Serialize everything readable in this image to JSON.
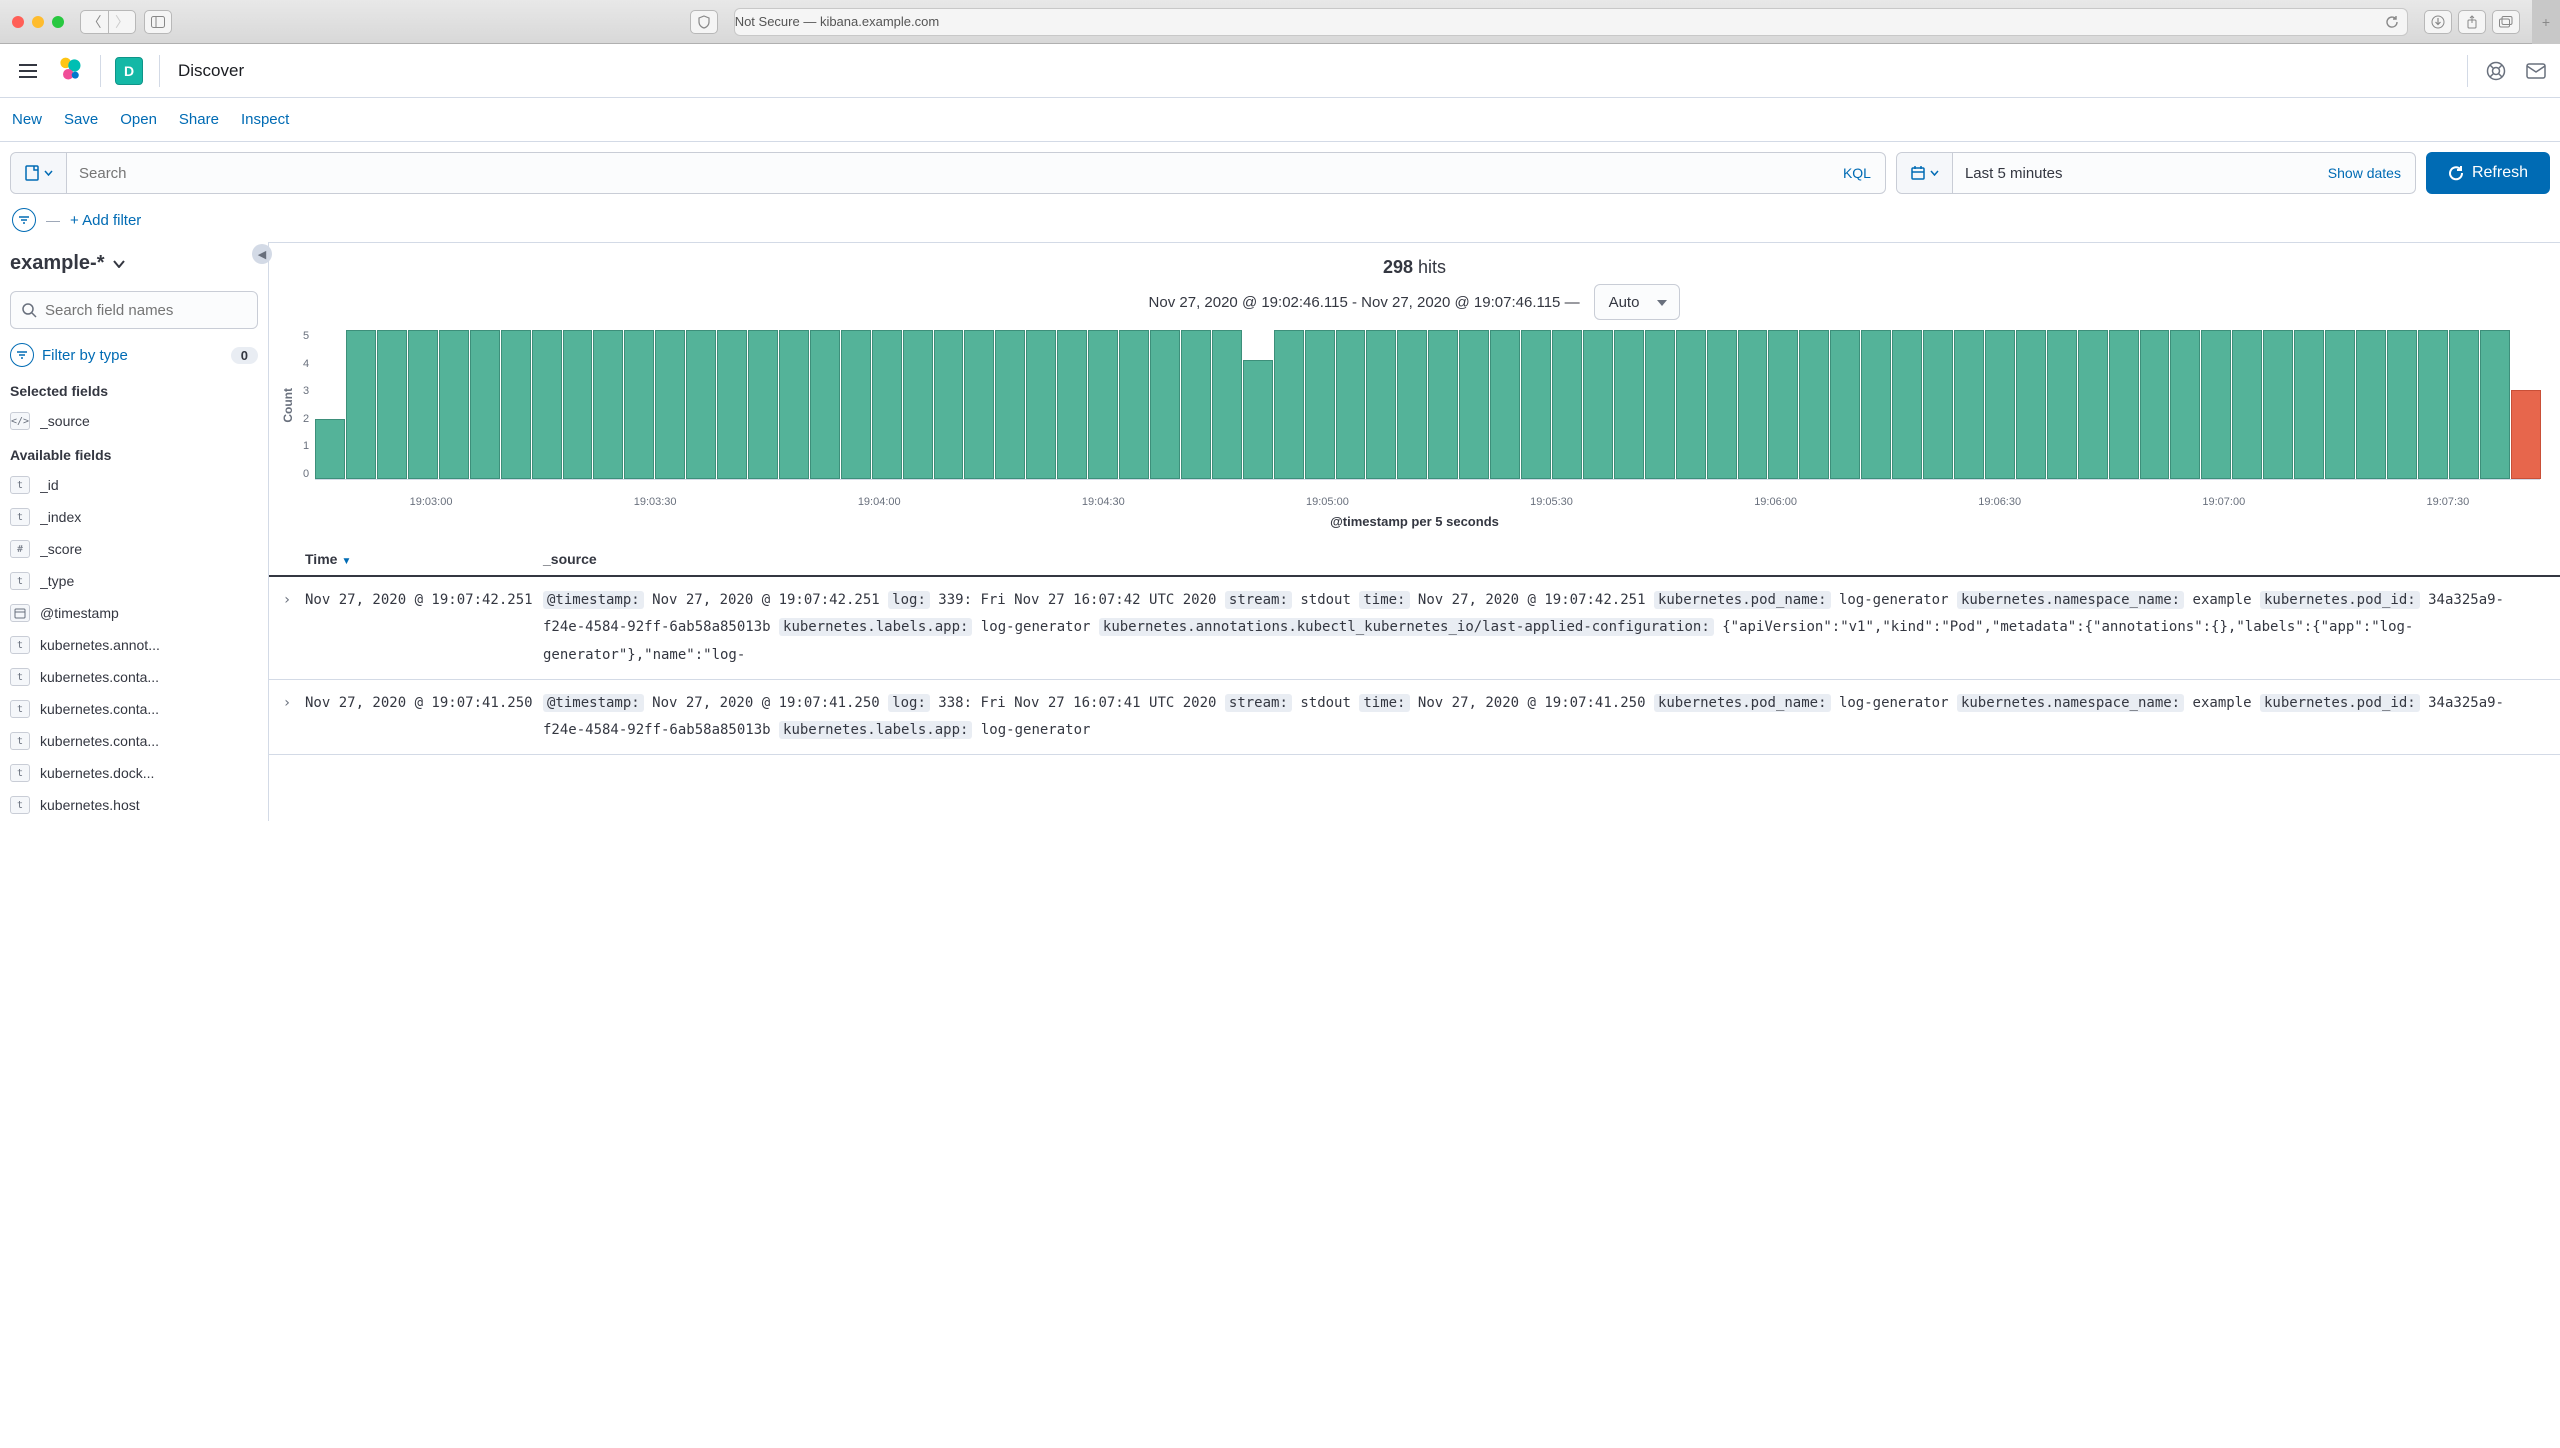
{
  "browser": {
    "url_label": "Not Secure — kibana.example.com"
  },
  "header": {
    "badge": "D",
    "title": "Discover"
  },
  "submenu": [
    "New",
    "Save",
    "Open",
    "Share",
    "Inspect"
  ],
  "search": {
    "placeholder": "Search",
    "kql": "KQL",
    "time_value": "Last 5 minutes",
    "show_dates": "Show dates",
    "refresh": "Refresh"
  },
  "filters": {
    "add_filter": "+ Add filter"
  },
  "sidebar": {
    "index_pattern": "example-*",
    "field_search_placeholder": "Search field names",
    "filter_by_type": "Filter by type",
    "type_count": "0",
    "selected_title": "Selected fields",
    "available_title": "Available fields",
    "selected_fields": [
      {
        "type": "src",
        "name": "_source"
      }
    ],
    "available_fields": [
      {
        "type": "t",
        "name": "_id"
      },
      {
        "type": "t",
        "name": "_index"
      },
      {
        "type": "#",
        "name": "_score"
      },
      {
        "type": "t",
        "name": "_type"
      },
      {
        "type": "date",
        "name": "@timestamp"
      },
      {
        "type": "t",
        "name": "kubernetes.annot..."
      },
      {
        "type": "t",
        "name": "kubernetes.conta..."
      },
      {
        "type": "t",
        "name": "kubernetes.conta..."
      },
      {
        "type": "t",
        "name": "kubernetes.conta..."
      },
      {
        "type": "t",
        "name": "kubernetes.dock..."
      },
      {
        "type": "t",
        "name": "kubernetes.host"
      }
    ]
  },
  "hits": {
    "count": "298",
    "label": "hits",
    "time_range": "Nov 27, 2020 @ 19:02:46.115 - Nov 27, 2020 @ 19:07:46.115 —",
    "interval": "Auto"
  },
  "chart_data": {
    "type": "bar",
    "ylabel": "Count",
    "xlabel": "@timestamp per 5 seconds",
    "y_ticks": [
      "5",
      "4",
      "3",
      "2",
      "1",
      "0"
    ],
    "x_ticks": [
      "19:03:00",
      "19:03:30",
      "19:04:00",
      "19:04:30",
      "19:05:00",
      "19:05:30",
      "19:06:00",
      "19:06:30",
      "19:07:00",
      "19:07:30"
    ],
    "values": [
      2,
      5,
      5,
      5,
      5,
      5,
      5,
      5,
      5,
      5,
      5,
      5,
      5,
      5,
      5,
      5,
      5,
      5,
      5,
      5,
      5,
      5,
      5,
      5,
      5,
      5,
      5,
      5,
      5,
      5,
      4,
      5,
      5,
      5,
      5,
      5,
      5,
      5,
      5,
      5,
      5,
      5,
      5,
      5,
      5,
      5,
      5,
      5,
      5,
      5,
      5,
      5,
      5,
      5,
      5,
      5,
      5,
      5,
      5,
      5,
      5,
      5,
      5,
      5,
      5,
      5,
      5,
      5,
      5,
      5,
      5,
      3
    ],
    "highlight_last": true
  },
  "table": {
    "col_time": "Time",
    "col_source": "_source",
    "rows": [
      {
        "time": "Nov 27, 2020 @ 19:07:42.251",
        "kvs": [
          {
            "k": "@timestamp:",
            "v": "Nov 27, 2020 @ 19:07:42.251"
          },
          {
            "k": "log:",
            "v": "339: Fri Nov 27 16:07:42 UTC 2020"
          },
          {
            "k": "stream:",
            "v": "stdout"
          },
          {
            "k": "time:",
            "v": "Nov 27, 2020 @ 19:07:42.251"
          },
          {
            "k": "kubernetes.pod_name:",
            "v": "log-generator"
          },
          {
            "k": "kubernetes.namespace_name:",
            "v": "example"
          },
          {
            "k": "kubernetes.pod_id:",
            "v": "34a325a9-f24e-4584-92ff-6ab58a85013b"
          },
          {
            "k": "kubernetes.labels.app:",
            "v": "log-generator"
          },
          {
            "k": "kubernetes.annotations.kubectl_kubernetes_io/last-applied-configuration:",
            "v": "{\"apiVersion\":\"v1\",\"kind\":\"Pod\",\"metadata\":{\"annotations\":{},\"labels\":{\"app\":\"log-generator\"},\"name\":\"log-"
          }
        ]
      },
      {
        "time": "Nov 27, 2020 @ 19:07:41.250",
        "kvs": [
          {
            "k": "@timestamp:",
            "v": "Nov 27, 2020 @ 19:07:41.250"
          },
          {
            "k": "log:",
            "v": "338: Fri Nov 27 16:07:41 UTC 2020"
          },
          {
            "k": "stream:",
            "v": "stdout"
          },
          {
            "k": "time:",
            "v": "Nov 27, 2020 @ 19:07:41.250"
          },
          {
            "k": "kubernetes.pod_name:",
            "v": "log-generator"
          },
          {
            "k": "kubernetes.namespace_name:",
            "v": "example"
          },
          {
            "k": "kubernetes.pod_id:",
            "v": "34a325a9-f24e-4584-92ff-6ab58a85013b"
          },
          {
            "k": "kubernetes.labels.app:",
            "v": "log-generator"
          }
        ]
      }
    ]
  }
}
